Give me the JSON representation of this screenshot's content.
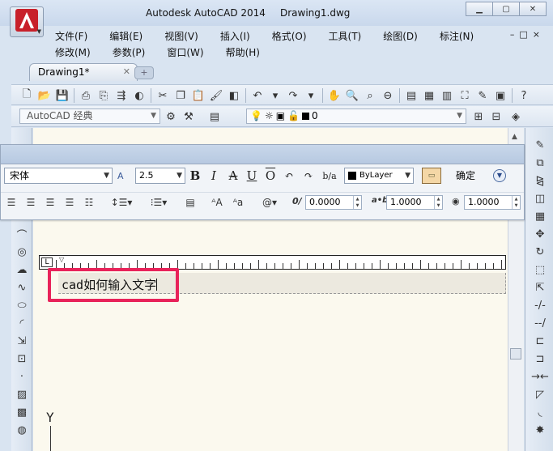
{
  "app": {
    "title": "Autodesk AutoCAD 2014",
    "file_name": "Drawing1.dwg"
  },
  "menu": {
    "row1": [
      "文件(F)",
      "编辑(E)",
      "视图(V)",
      "插入(I)",
      "格式(O)",
      "工具(T)",
      "绘图(D)",
      "标注(N)"
    ],
    "row2": [
      "修改(M)",
      "参数(P)",
      "窗口(W)",
      "帮助(H)"
    ]
  },
  "tab": {
    "label": "Drawing1*"
  },
  "toolbar": {
    "workspace": "AutoCAD 经典",
    "layer_value": "0"
  },
  "text_editor": {
    "font": "宋体",
    "text_height": "2.5",
    "color": "ByLayer",
    "ok_label": "确定",
    "oblique": "0.0000",
    "tracking": "1.0000",
    "width_factor": "1.0000"
  },
  "mtext": {
    "content": "cad如何输入文字"
  },
  "colors": {
    "highlight": "#e8235a",
    "canvas": "#fbf9ee",
    "logo_red": "#c8202a"
  }
}
